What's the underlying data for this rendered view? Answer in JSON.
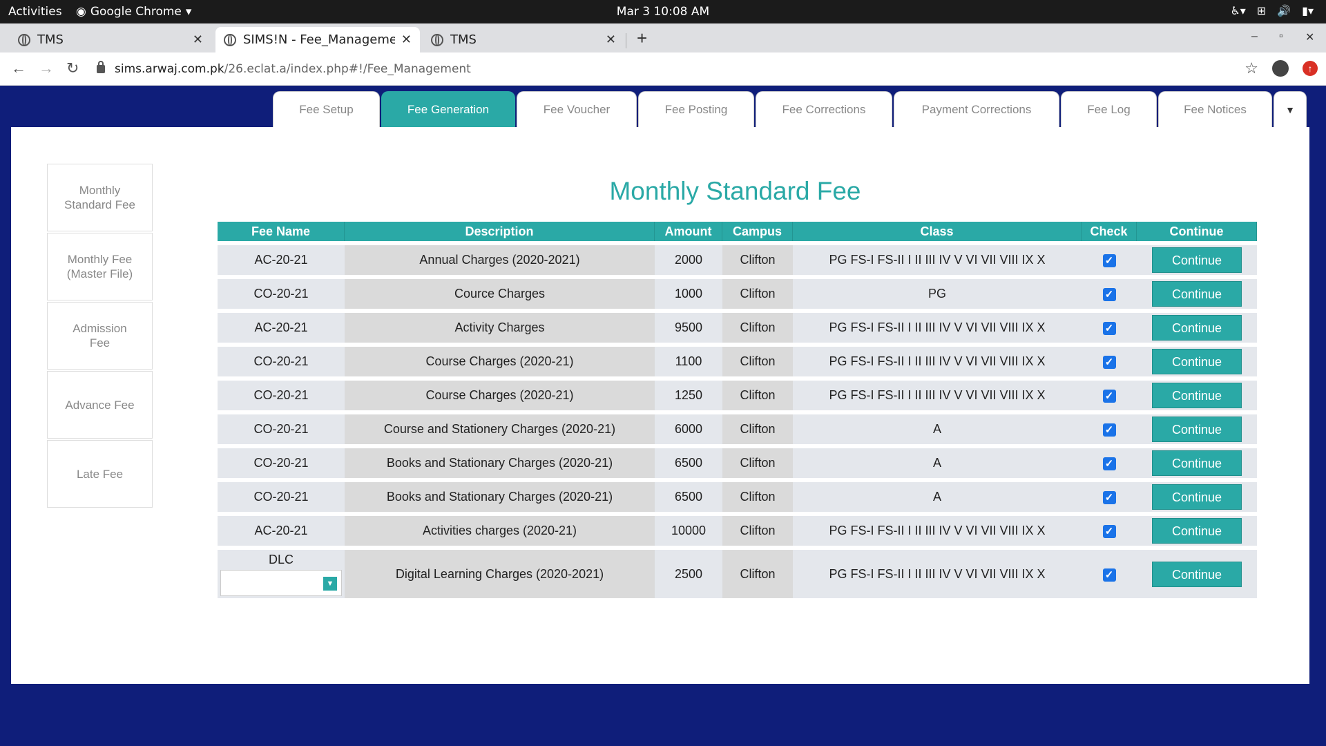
{
  "os": {
    "activities": "Activities",
    "app_name": "Google Chrome",
    "clock": "Mar 3  10:08 AM"
  },
  "browser": {
    "tabs": [
      {
        "title": "TMS",
        "active": false
      },
      {
        "title": "SIMS!N - Fee_Management",
        "active": true
      },
      {
        "title": "TMS",
        "active": false
      }
    ],
    "url_domain": "sims.arwaj.com.pk",
    "url_path": "/26.eclat.a/index.php#!/Fee_Management"
  },
  "app_tabs": [
    "Fee Setup",
    "Fee Generation",
    "Fee Voucher",
    "Fee Posting",
    "Fee Corrections",
    "Payment Corrections",
    "Fee Log",
    "Fee Notices"
  ],
  "active_tab": "Fee Generation",
  "side_menu": [
    "Monthly Standard Fee",
    "Monthly Fee (Master File)",
    "Admission Fee",
    "Advance Fee",
    "Late Fee"
  ],
  "page_title": "Monthly Standard Fee",
  "table": {
    "headers": [
      "Fee Name",
      "Description",
      "Amount",
      "Campus",
      "Class",
      "Check",
      "Continue"
    ],
    "rows": [
      {
        "fee_name": "AC-20-21",
        "description": "Annual Charges (2020-2021)",
        "amount": "2000",
        "campus": "Clifton",
        "class": "PG FS-I FS-II I II III IV V VI VII VIII IX X",
        "checked": true,
        "button": "Continue"
      },
      {
        "fee_name": "CO-20-21",
        "description": "Cource Charges",
        "amount": "1000",
        "campus": "Clifton",
        "class": "PG",
        "checked": true,
        "button": "Continue"
      },
      {
        "fee_name": "AC-20-21",
        "description": "Activity Charges",
        "amount": "9500",
        "campus": "Clifton",
        "class": "PG FS-I FS-II I II III IV V VI VII VIII IX X",
        "checked": true,
        "button": "Continue"
      },
      {
        "fee_name": "CO-20-21",
        "description": "Course Charges (2020-21)",
        "amount": "1100",
        "campus": "Clifton",
        "class": "PG FS-I FS-II I II III IV V VI VII VIII IX X",
        "checked": true,
        "button": "Continue"
      },
      {
        "fee_name": "CO-20-21",
        "description": "Course Charges (2020-21)",
        "amount": "1250",
        "campus": "Clifton",
        "class": "PG FS-I FS-II I II III IV V VI VII VIII IX X",
        "checked": true,
        "button": "Continue"
      },
      {
        "fee_name": "CO-20-21",
        "description": "Course and Stationery Charges (2020-21)",
        "amount": "6000",
        "campus": "Clifton",
        "class": "A",
        "checked": true,
        "button": "Continue"
      },
      {
        "fee_name": "CO-20-21",
        "description": "Books and Stationary Charges (2020-21)",
        "amount": "6500",
        "campus": "Clifton",
        "class": "A",
        "checked": true,
        "button": "Continue"
      },
      {
        "fee_name": "CO-20-21",
        "description": "Books and Stationary Charges (2020-21)",
        "amount": "6500",
        "campus": "Clifton",
        "class": "A",
        "checked": true,
        "button": "Continue"
      },
      {
        "fee_name": "AC-20-21",
        "description": "Activities charges (2020-21)",
        "amount": "10000",
        "campus": "Clifton",
        "class": "PG FS-I FS-II I II III IV V VI VII VIII IX X",
        "checked": true,
        "button": "Continue"
      },
      {
        "fee_name": "DLC",
        "description": "Digital Learning Charges (2020-2021)",
        "amount": "2500",
        "campus": "Clifton",
        "class": "PG FS-I FS-II I II III IV V VI VII VIII IX X",
        "checked": true,
        "button": "Continue",
        "has_select": true
      }
    ]
  },
  "colors": {
    "accent": "#2aa9a6",
    "background": "#0f1e7a"
  }
}
